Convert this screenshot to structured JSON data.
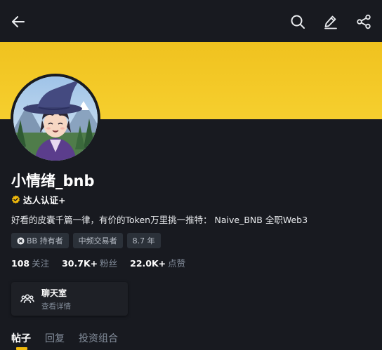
{
  "header": {
    "back_icon": "arrow-left-icon",
    "search_icon": "search-icon",
    "edit_icon": "edit-pen-icon",
    "share_icon": "share-icon"
  },
  "colors": {
    "background": "#181a20",
    "banner": "#f0c21f",
    "accent": "#f0b90b",
    "tag_bg": "#2b3139",
    "muted": "#848e9c"
  },
  "profile": {
    "name": "小情绪_bnb",
    "verified_label": "达人认证+",
    "bio": "好看的皮囊千篇一律，有价的Token万里挑一推特： Naive_BNB 全职Web3",
    "tags": [
      {
        "label": "BB 持有者",
        "icon": "x-circle-icon"
      },
      {
        "label": "中频交易者"
      },
      {
        "label": "8.7 年"
      }
    ]
  },
  "stats": [
    {
      "value": "108",
      "label": "关注"
    },
    {
      "value": "30.7K+",
      "label": "粉丝"
    },
    {
      "value": "22.0K+",
      "label": "点赞"
    }
  ],
  "chat_room": {
    "title": "聊天室",
    "subtitle": "查看详情",
    "icon": "group-users-icon"
  },
  "tabs": [
    {
      "label": "帖子",
      "active": true
    },
    {
      "label": "回复",
      "active": false
    },
    {
      "label": "投资组合",
      "active": false
    }
  ]
}
